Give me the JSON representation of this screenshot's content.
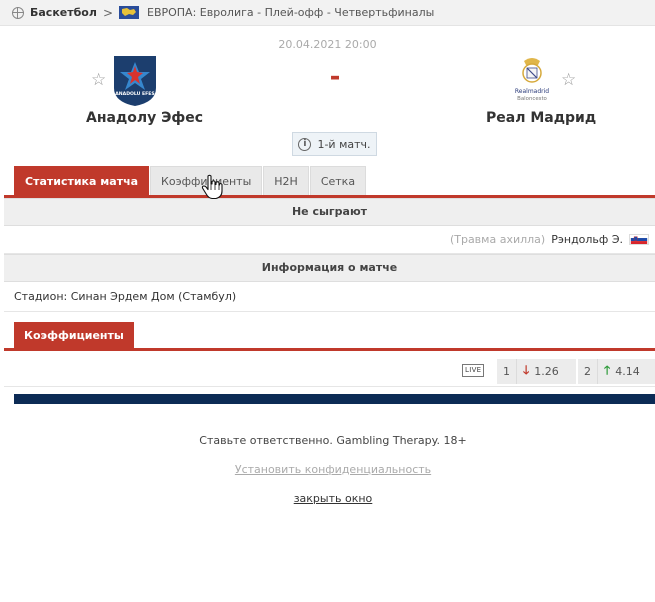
{
  "breadcrumb": {
    "sport": "Баскетбол",
    "separator": ">",
    "league": "ЕВРОПА: Евролига - Плей-офф - Четвертьфиналы"
  },
  "match": {
    "date": "20.04.2021 20:00",
    "score": "-",
    "home_team": "Анадолу Эфес",
    "away_team": "Реал Мадрид",
    "info_badge": "1-й матч.",
    "star_glyph": "☆",
    "home_logo_text": "ANADOLU EFES",
    "away_logo_text": {
      "line1": "Realmadrid",
      "line2": "Baloncesto"
    }
  },
  "tabs": [
    {
      "label": "Статистика матча",
      "active": true
    },
    {
      "label": "Коэффициенты",
      "active": false
    },
    {
      "label": "H2H",
      "active": false
    },
    {
      "label": "Сетка",
      "active": false
    }
  ],
  "missing": {
    "title": "Не сыграют",
    "reason": "(Травма ахилла)",
    "player": "Рэндольф Э."
  },
  "match_info": {
    "title": "Информация о матче",
    "stadium": "Стадион: Синан Эрдем Дом (Стамбул)"
  },
  "odds": {
    "tab_label": "Коэффициенты",
    "live_label": "LIVE",
    "home": {
      "label": "1",
      "value": "1.26",
      "trend": "down"
    },
    "away": {
      "label": "2",
      "value": "4.14",
      "trend": "up"
    },
    "arrow_down": "🡓",
    "arrow_up": "🡑"
  },
  "footer": {
    "responsible": "Ставьте ответственно. Gambling Therapy. 18+",
    "privacy": "Установить конфиденциальность",
    "close": "закрыть окно"
  },
  "colors": {
    "accent": "#c0392b",
    "navy": "#0c2b55",
    "tab_bg": "#e9e9e9",
    "odds_down": "#c0392b",
    "odds_up": "#2e9b3a"
  }
}
